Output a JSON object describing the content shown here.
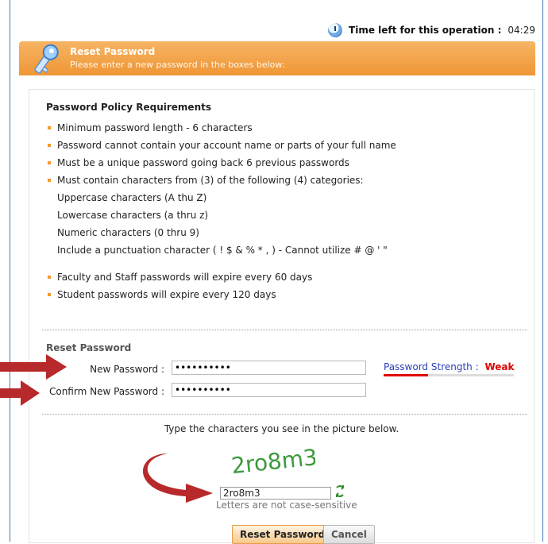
{
  "timer": {
    "label": "Time left for this operation :",
    "value": "04:29"
  },
  "header": {
    "title": "Reset Password",
    "subtitle": "Please enter a new password in the boxes below:"
  },
  "policy": {
    "title": "Password Policy Requirements",
    "items": [
      "Minimum password length - 6 characters",
      "Password cannot contain your account name or parts of your full name",
      "Must be a unique password going back 6 previous passwords",
      "Must contain characters from (3) of the following (4) categories:"
    ],
    "categories": [
      "Uppercase characters (A thu Z)",
      "Lowercase characters (a thru z)",
      "Numeric characters (0 thru 9)",
      "Include a punctuation character ( ! $ & % * , ) - Cannot utilize # @ ' \""
    ],
    "expiry": [
      "Faculty and Staff passwords will expire every 60 days",
      "Student passwords will expire every 120 days"
    ]
  },
  "reset": {
    "section_label": "Reset Password",
    "new_password_label": "New Password :",
    "new_password_value": "••••••••••",
    "confirm_password_label": "Confirm New Password :",
    "confirm_password_value": "••••••••••",
    "strength_label": "Password Strength :",
    "strength_value": "Weak",
    "strength_fraction": 0.34
  },
  "captcha": {
    "instruction": "Type the characters you see in the picture below.",
    "image_text": "2ro8m3",
    "input_value": "2ro8m3",
    "note": "Letters are not case-sensitive"
  },
  "buttons": {
    "reset": "Reset Password",
    "cancel": "Cancel"
  },
  "colors": {
    "header_orange": "#ef9635",
    "arrow_red": "#b8292b",
    "strength_weak": "#e00000",
    "captcha_green": "#3c9a3c"
  }
}
